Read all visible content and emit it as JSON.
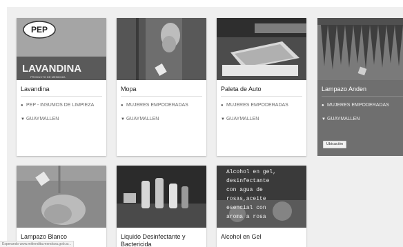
{
  "products_row1": [
    {
      "title": "Lavandina",
      "seller": "PEP - INSUMOS DE LIMPIEZA",
      "location": "GUAYMALLEN",
      "image_text": {
        "brand": "PEP",
        "small": "PRODUCTO DE MENDOZA",
        "big": "LAVANDINA"
      }
    },
    {
      "title": "Mopa",
      "seller": "MUJERES EMPODERADAS",
      "location": "GUAYMALLEN"
    },
    {
      "title": "Paleta de Auto",
      "seller": "MUJERES EMPODERADAS",
      "location": "GUAYMALLEN"
    },
    {
      "title": "Lampazo Anden",
      "seller": "MUJERES EMPODERADAS",
      "location": "GUAYMALLEN",
      "button": "Ubicación"
    }
  ],
  "products_row2": [
    {
      "title": "Lampazo Blanco"
    },
    {
      "title": "Liquido Desinfectante y Bactericida"
    },
    {
      "title": "Alcohol en Gel",
      "image_text": [
        "Alcohol en gel,",
        "desinfectante",
        "con agua de",
        "rosas,aceite",
        "esencial con",
        "aroma a rosa"
      ]
    }
  ],
  "status_bar": "Esperando www.mitiendita.mendoza.gob.ar...",
  "colors": {
    "page_bg": "#efefef",
    "card_bg": "#ffffff",
    "active_card": "#6f6f6f"
  }
}
